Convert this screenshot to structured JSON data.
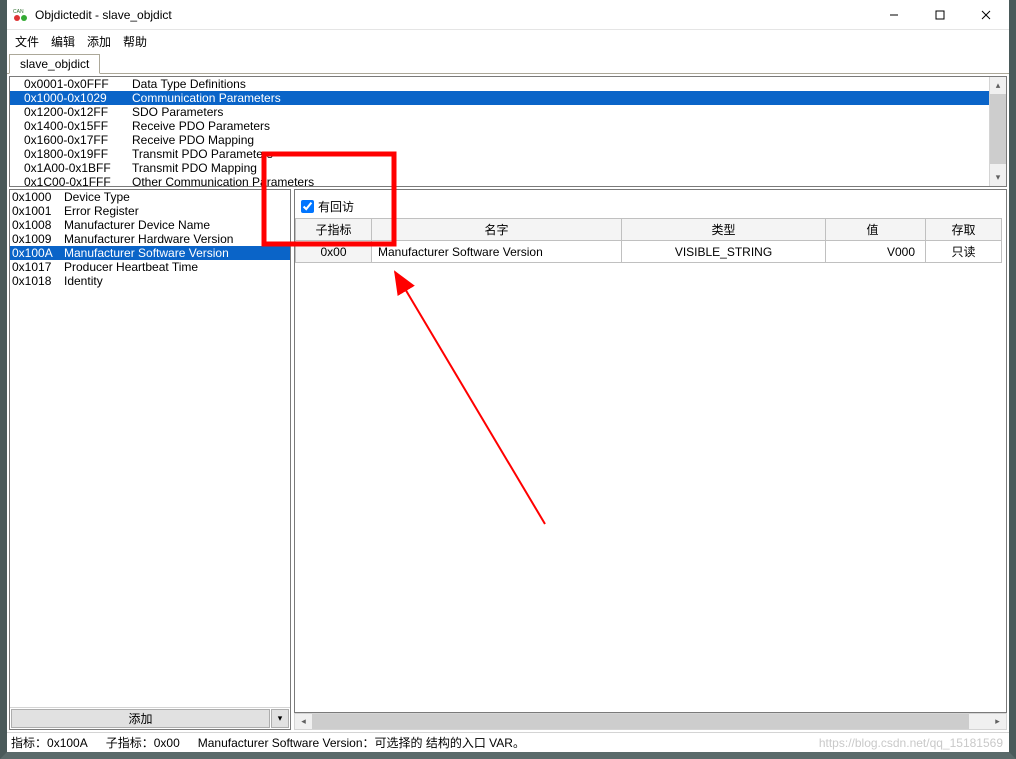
{
  "window": {
    "title": "Objdictedit - slave_objdict"
  },
  "menu": {
    "items": [
      "文件",
      "编辑",
      "添加",
      "帮助"
    ]
  },
  "tab": {
    "label": "slave_objdict"
  },
  "ranges": [
    {
      "code": "0x0001-0x0FFF",
      "label": "Data Type Definitions"
    },
    {
      "code": "0x1000-0x1029",
      "label": "Communication Parameters",
      "selected": true
    },
    {
      "code": "0x1200-0x12FF",
      "label": "SDO Parameters"
    },
    {
      "code": "0x1400-0x15FF",
      "label": "Receive PDO Parameters"
    },
    {
      "code": "0x1600-0x17FF",
      "label": "Receive PDO Mapping"
    },
    {
      "code": "0x1800-0x19FF",
      "label": "Transmit PDO Parameters"
    },
    {
      "code": "0x1A00-0x1BFF",
      "label": "Transmit PDO Mapping"
    },
    {
      "code": "0x1C00-0x1FFF",
      "label": "Other Communication Parameters"
    }
  ],
  "indexes": [
    {
      "code": "0x1000",
      "label": "Device Type"
    },
    {
      "code": "0x1001",
      "label": "Error Register"
    },
    {
      "code": "0x1008",
      "label": "Manufacturer Device Name"
    },
    {
      "code": "0x1009",
      "label": "Manufacturer Hardware Version"
    },
    {
      "code": "0x100A",
      "label": "Manufacturer Software Version",
      "selected": true
    },
    {
      "code": "0x1017",
      "label": "Producer Heartbeat Time"
    },
    {
      "code": "0x1018",
      "label": "Identity"
    }
  ],
  "index_toolbar": {
    "add_label": "添加"
  },
  "detail": {
    "callback_label": "有回访",
    "callback_checked": true,
    "columns": {
      "subindex": "子指标",
      "name": "名字",
      "type": "类型",
      "value": "值",
      "access": "存取"
    },
    "rows": [
      {
        "rowhead": "0x00",
        "name": "Manufacturer Software Version",
        "type": "VISIBLE_STRING",
        "value": "V000",
        "access": "只读"
      }
    ]
  },
  "status": {
    "index_label": "指标：",
    "index_value": "0x100A",
    "subindex_label": "子指标：",
    "subindex_value": "0x00",
    "desc": "Manufacturer Software Version：可选择的 结构的入口 VAR。"
  },
  "watermark": "https://blog.csdn.net/qq_15181569"
}
